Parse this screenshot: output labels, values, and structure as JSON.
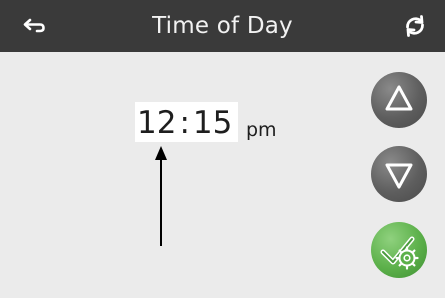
{
  "header": {
    "title": "Time of Day",
    "back_icon": "back-arrow-icon",
    "refresh_icon": "refresh-icon"
  },
  "time": {
    "hours": "12",
    "separator": ":",
    "minutes": "15",
    "ampm": "pm"
  },
  "controls": {
    "up_icon": "triangle-up-icon",
    "down_icon": "triangle-down-icon",
    "save_icon": "check-gear-icon"
  },
  "colors": {
    "header_bg": "#3a3a3a",
    "body_bg": "#ebebeb",
    "button_gray": "#5e5e5e",
    "button_green": "#5cb04a"
  }
}
